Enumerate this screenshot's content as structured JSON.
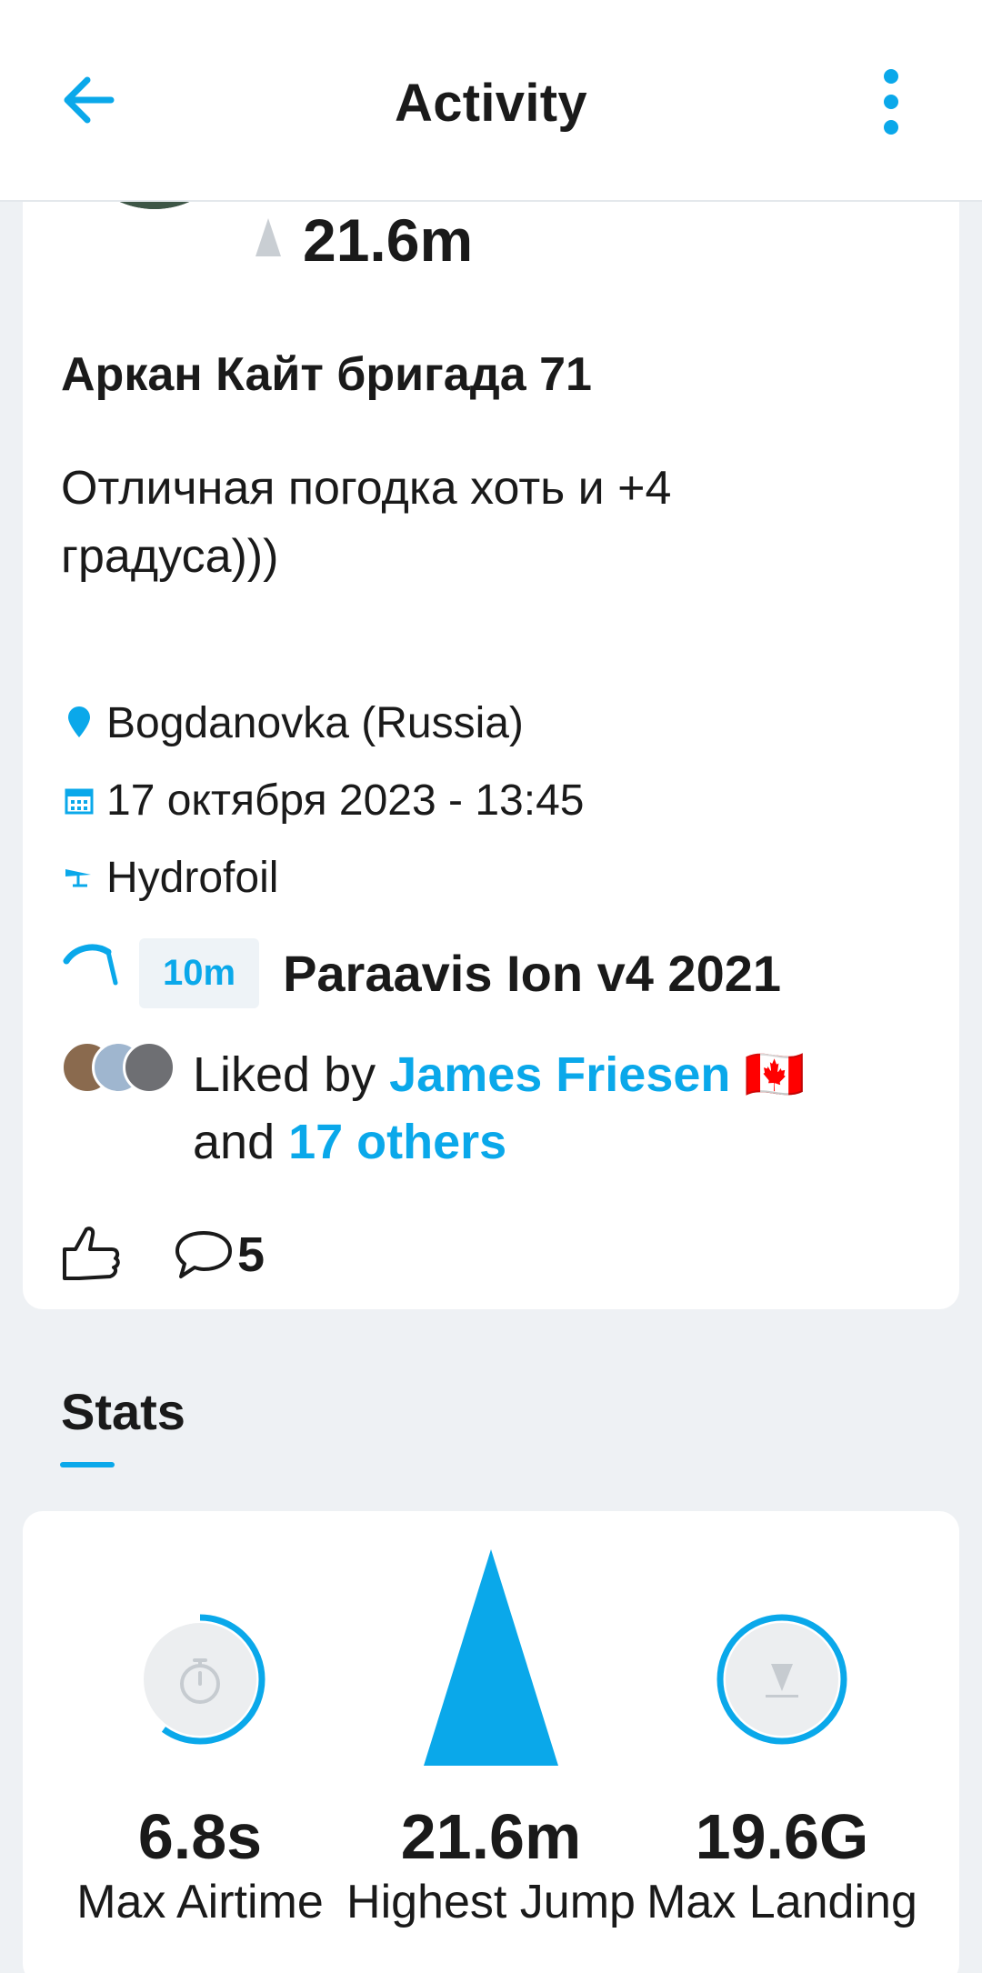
{
  "appbar": {
    "title": "Activity",
    "back_icon": "arrow-left-icon",
    "more_icon": "more-vert-icon"
  },
  "post": {
    "header_jump": "21.6m",
    "spot_title": "Аркан Кайт бригада 71",
    "description": "Отличная погодка хоть и +4 градуса)))",
    "location": "Bogdanovka (Russia)",
    "date": "17 октября 2023 - 13:45",
    "sport": "Hydrofoil",
    "kite_size": "10m",
    "kite_name": "Paraavis Ion v4 2021",
    "likes": {
      "prefix": "Liked by ",
      "first_liker": "James Friesen",
      "flag": "🇨🇦",
      "joiner": "and ",
      "others": "17 others"
    },
    "comments_count": "5"
  },
  "stats": {
    "tab_label": "Stats",
    "items": [
      {
        "value": "6.8s",
        "label": "Max Airtime",
        "ring_fraction": 0.6
      },
      {
        "value": "21.6m",
        "label": "Highest Jump"
      },
      {
        "value": "19.6G",
        "label": "Max Landing",
        "ring_fraction": 1.0
      }
    ]
  },
  "colors": {
    "accent": "#0aa8ea",
    "background": "#eef1f4",
    "card": "#ffffff"
  }
}
